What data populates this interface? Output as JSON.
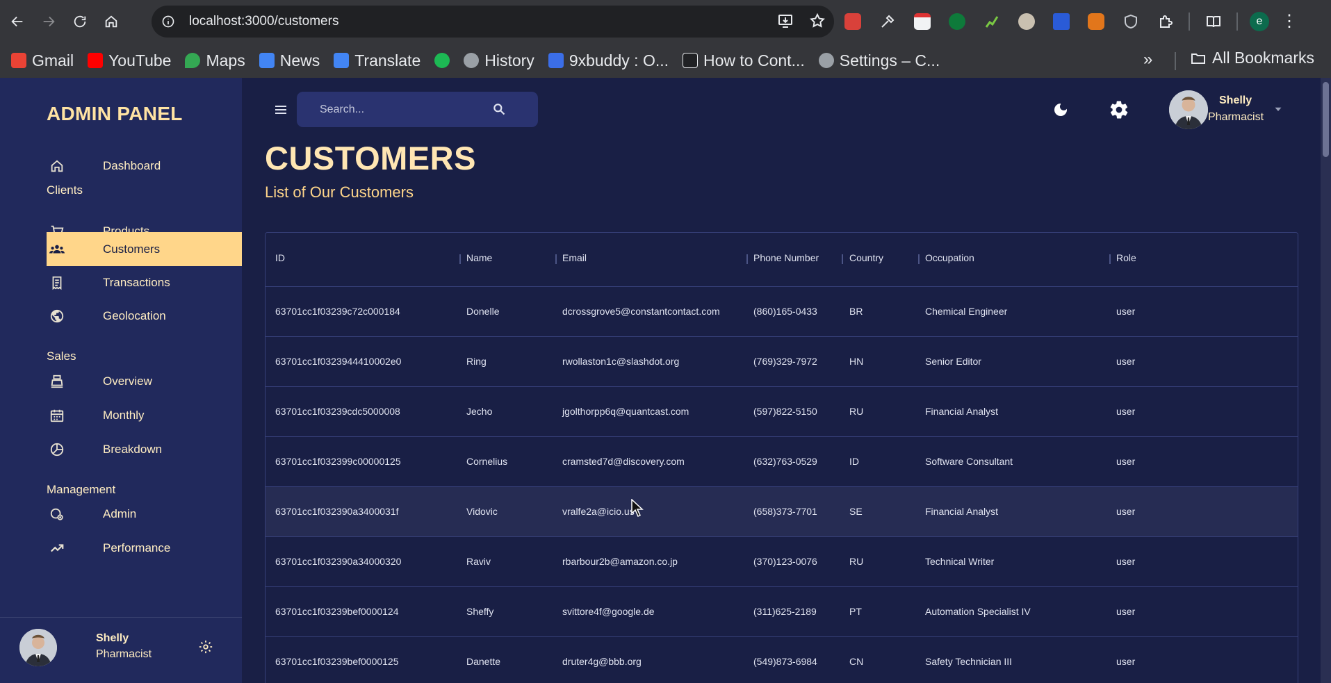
{
  "browser": {
    "url": "localhost:3000/customers",
    "bookmarks": [
      {
        "label": "Gmail",
        "color": "#ea4335"
      },
      {
        "label": "YouTube",
        "color": "#ff0000"
      },
      {
        "label": "Maps",
        "color": "#34a853"
      },
      {
        "label": "News",
        "color": "#4285f4"
      },
      {
        "label": "Translate",
        "color": "#4285f4"
      },
      {
        "label": "",
        "color": "#1db954"
      },
      {
        "label": "History",
        "color": "#9aa0a6"
      },
      {
        "label": "9xbuddy : O...",
        "color": "#3b6ee8"
      },
      {
        "label": "How to Cont...",
        "color": "#202124"
      },
      {
        "label": "Settings – C...",
        "color": "#9aa0a6"
      }
    ],
    "all_bookmarks": "All Bookmarks",
    "profile_initial": "e"
  },
  "sidebar": {
    "brand": "ADMIN PANEL",
    "dashboard": "Dashboard",
    "section_clients": "Clients",
    "products": "Products",
    "customers": "Customers",
    "transactions": "Transactions",
    "geolocation": "Geolocation",
    "section_sales": "Sales",
    "overview": "Overview",
    "monthly": "Monthly",
    "breakdown": "Breakdown",
    "section_management": "Management",
    "admin": "Admin",
    "performance": "Performance",
    "user_name": "Shelly",
    "user_role": "Pharmacist"
  },
  "topbar": {
    "search_placeholder": "Search...",
    "user_name": "Shelly",
    "user_role": "Pharmacist"
  },
  "page": {
    "title": "CUSTOMERS",
    "subtitle": "List of Our Customers"
  },
  "table": {
    "columns": [
      "ID",
      "Name",
      "Email",
      "Phone Number",
      "Country",
      "Occupation",
      "Role"
    ],
    "rows": [
      {
        "id": "63701cc1f03239c72c000184",
        "name": "Donelle",
        "email": "dcrossgrove5@constantcontact.com",
        "phone": "(860)165-0433",
        "country": "BR",
        "occupation": "Chemical Engineer",
        "role": "user"
      },
      {
        "id": "63701cc1f0323944410002e0",
        "name": "Ring",
        "email": "rwollaston1c@slashdot.org",
        "phone": "(769)329-7972",
        "country": "HN",
        "occupation": "Senior Editor",
        "role": "user"
      },
      {
        "id": "63701cc1f03239cdc5000008",
        "name": "Jecho",
        "email": "jgolthorpp6q@quantcast.com",
        "phone": "(597)822-5150",
        "country": "RU",
        "occupation": "Financial Analyst",
        "role": "user"
      },
      {
        "id": "63701cc1f032399c00000125",
        "name": "Cornelius",
        "email": "cramsted7d@discovery.com",
        "phone": "(632)763-0529",
        "country": "ID",
        "occupation": "Software Consultant",
        "role": "user"
      },
      {
        "id": "63701cc1f032390a3400031f",
        "name": "Vidovic",
        "email": "vralfe2a@icio.us",
        "phone": "(658)373-7701",
        "country": "SE",
        "occupation": "Financial Analyst",
        "role": "user"
      },
      {
        "id": "63701cc1f032390a34000320",
        "name": "Raviv",
        "email": "rbarbour2b@amazon.co.jp",
        "phone": "(370)123-0076",
        "country": "RU",
        "occupation": "Technical Writer",
        "role": "user"
      },
      {
        "id": "63701cc1f03239bef0000124",
        "name": "Sheffy",
        "email": "svittore4f@google.de",
        "phone": "(311)625-2189",
        "country": "PT",
        "occupation": "Automation Specialist IV",
        "role": "user"
      },
      {
        "id": "63701cc1f03239bef0000125",
        "name": "Danette",
        "email": "druter4g@bbb.org",
        "phone": "(549)873-6984",
        "country": "CN",
        "occupation": "Safety Technician III",
        "role": "user"
      }
    ]
  },
  "colors": {
    "background": "#191f45",
    "sidebar": "#21295c",
    "accent": "#ffd68a",
    "title": "#ffe6b3"
  }
}
